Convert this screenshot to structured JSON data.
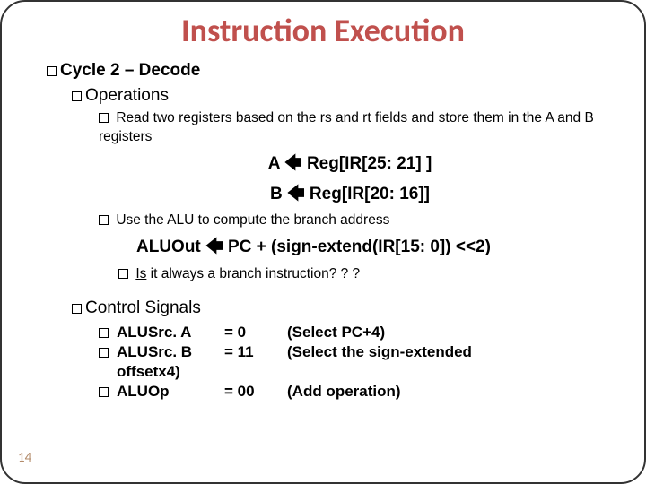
{
  "title": "Instruction Execution",
  "cycle": {
    "label": "Cycle 2 – Decode"
  },
  "operations": {
    "heading": "Operations",
    "bullet1": "Read two registers based on the rs and rt fields and store them in the A and B registers",
    "eqA_left": "A",
    "eqA_right": "Reg[IR[25: 21] ]",
    "eqB_left": "B",
    "eqB_right": "Reg[IR[20: 16]]",
    "bullet2": "Use the ALU to compute the branch address",
    "aluout_left": "ALUOut",
    "aluout_right": "PC + (sign-extend(IR[15: 0]) <<2)",
    "is_underlined": "Is",
    "is_rest": " it always a branch instruction? ? ?"
  },
  "control": {
    "heading": "Control Signals",
    "rows": [
      {
        "name": "ALUSrc. A",
        "val": "= 0",
        "desc": "(Select PC+4)"
      },
      {
        "name": "ALUSrc. B",
        "val": "= 11",
        "desc": "(Select the sign-extended"
      },
      {
        "name_cont": "offsetx4)"
      },
      {
        "name": "ALUOp",
        "val": "= 00",
        "desc": "(Add operation)"
      }
    ]
  },
  "page_number": "14",
  "arrow_glyph": "🡸"
}
